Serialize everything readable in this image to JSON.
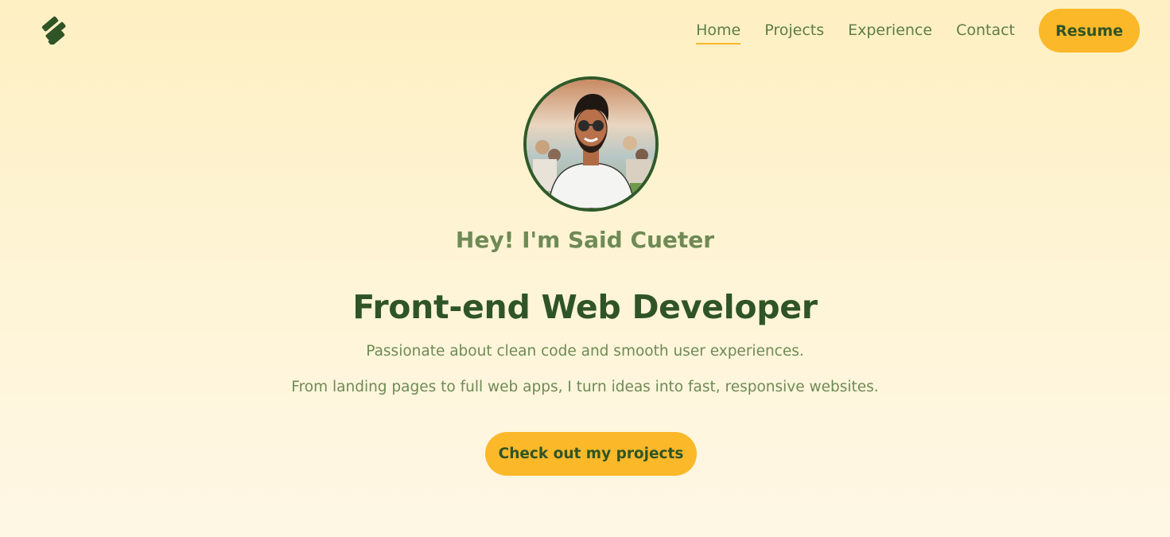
{
  "header": {
    "logo_icon": "stacked-slashes-logo-icon",
    "nav": [
      {
        "label": "Home",
        "active": true
      },
      {
        "label": "Projects",
        "active": false
      },
      {
        "label": "Experience",
        "active": false
      },
      {
        "label": "Contact",
        "active": false
      }
    ],
    "resume_label": "Resume"
  },
  "hero": {
    "avatar_icon": "profile-avatar",
    "greeting": "Hey! I'm Said Cueter",
    "title": "Front-end Web Developer",
    "subtitle_1": "Passionate about clean code and smooth user experiences.",
    "subtitle_2": "From landing pages to full web apps, I turn ideas into fast, responsive websites.",
    "cta_label": "Check out my projects"
  },
  "colors": {
    "accent": "#fbb829",
    "primary_green": "#2f5425",
    "muted_green": "#6f8a55",
    "background": "#fef4d6"
  }
}
